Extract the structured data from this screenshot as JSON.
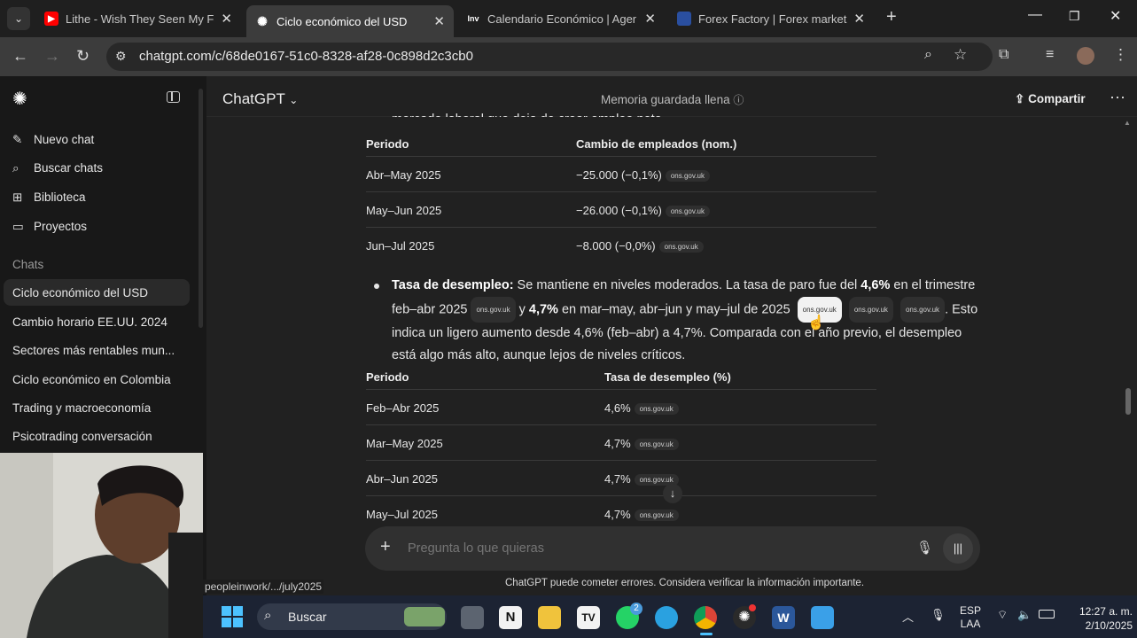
{
  "browser": {
    "tabs": [
      {
        "title": "Lithe - Wish They Seen My Face",
        "favicon": "youtube-icon"
      },
      {
        "title": "Ciclo económico del USD",
        "favicon": "chatgpt-icon"
      },
      {
        "title": "Calendario Económico | Agenda",
        "favicon": "investing-icon"
      },
      {
        "title": "Forex Factory | Forex markets fo",
        "favicon": "forexfactory-icon"
      }
    ],
    "url": "chatgpt.com/c/68de0167-51c0-8328-af28-0c898d2c3cb0"
  },
  "sidebar": {
    "actions": [
      {
        "label": "Nuevo chat",
        "icon": "edit-icon"
      },
      {
        "label": "Buscar chats",
        "icon": "search-icon"
      },
      {
        "label": "Biblioteca",
        "icon": "library-icon"
      },
      {
        "label": "Proyectos",
        "icon": "folder-icon"
      }
    ],
    "chats_heading": "Chats",
    "chats": [
      "Ciclo económico del USD",
      "Cambio horario EE.UU. 2024",
      "Sectores más rentables mun...",
      "Ciclo económico en Colombia",
      "Trading y macroeconomía",
      "Psicotrading conversación"
    ]
  },
  "header": {
    "title": "ChatGPT",
    "memory": "Memoria guardada llena",
    "share": "Compartir"
  },
  "content": {
    "cut_line": "mercado laboral que deja de crear empleo neto.",
    "table1": {
      "headers": [
        "Periodo",
        "Cambio de empleados (nom.)"
      ],
      "rows": [
        {
          "period": "Abr–May 2025",
          "value": "−25.000 (−0,1%)",
          "cite": "ons.gov.uk"
        },
        {
          "period": "May–Jun 2025",
          "value": "−26.000 (−0,1%)",
          "cite": "ons.gov.uk"
        },
        {
          "period": "Jun–Jul 2025",
          "value": "−8.000 (−0,0%)",
          "cite": "ons.gov.uk"
        }
      ]
    },
    "bullet": {
      "bold_label": "Tasa de desempleo:",
      "t1": " Se mantiene en niveles moderados. La tasa de paro fue del ",
      "v1": "4,6%",
      "t2": " en el trimestre feb–abr 2025",
      "t3": " y ",
      "v2": "4,7%",
      "t4": " en mar–may, abr–jun y may–jul de 2025",
      "t5": ". Esto indica un ligero aumento desde 4,6% (feb–abr) a 4,7%. Comparada con el año previo, el desempleo está algo más alto, aunque lejos de niveles críticos.",
      "cite": "ons.gov.uk"
    },
    "table2": {
      "headers": [
        "Periodo",
        "Tasa de desempleo (%)"
      ],
      "rows": [
        {
          "period": "Feb–Abr 2025",
          "value": "4,6%",
          "cite": "ons.gov.uk"
        },
        {
          "period": "Mar–May 2025",
          "value": "4,7%",
          "cite": "ons.gov.uk"
        },
        {
          "period": "Abr–Jun 2025",
          "value": "4,7%",
          "cite": "ons.gov.uk"
        },
        {
          "period": "May–Jul 2025",
          "value": "4,7%",
          "cite": "ons.gov.uk"
        }
      ]
    }
  },
  "composer": {
    "placeholder": "Pregunta lo que quieras"
  },
  "disclaimer": "ChatGPT puede cometer errores. Considera verificar la información importante.",
  "status_url": "peopleinwork/.../july2025",
  "taskbar": {
    "search": "Buscar",
    "whatsapp_badge": "2",
    "lang1": "ESP",
    "lang2": "LAA",
    "time": "12:27 a. m.",
    "date": "2/10/2025"
  }
}
